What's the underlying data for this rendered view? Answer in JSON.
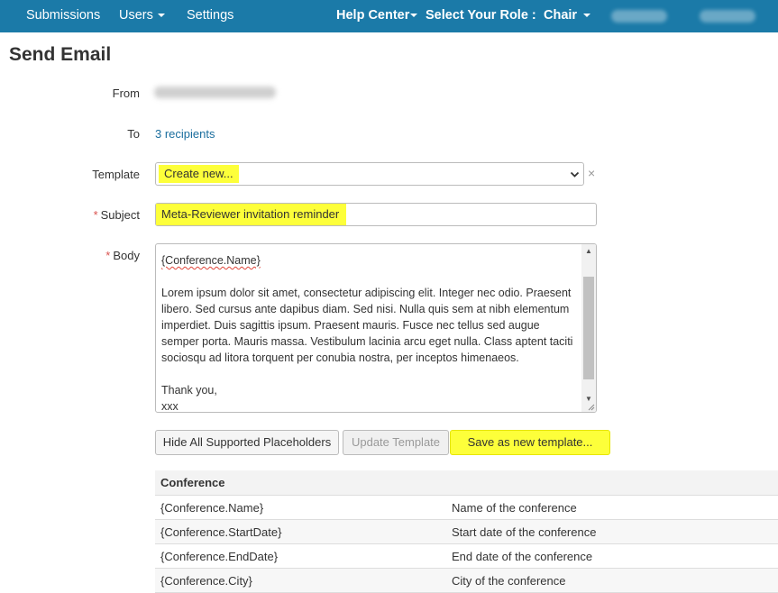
{
  "nav": {
    "submissions": "Submissions",
    "users": "Users",
    "settings": "Settings",
    "help_center": "Help Center",
    "role_label": "Select Your Role :",
    "role_value": "Chair"
  },
  "page_title": "Send Email",
  "form": {
    "from_label": "From",
    "to_label": "To",
    "to_value": "3 recipients",
    "template_label": "Template",
    "template_value": "Create new...",
    "clear_icon": "×",
    "subject_label": "Subject",
    "subject_value": "Meta-Reviewer invitation reminder",
    "body_label": "Body",
    "required_mark": "*"
  },
  "body_text": {
    "line1": "{Conference.Name}",
    "paragraph": "Lorem ipsum dolor sit amet, consectetur adipiscing elit. Integer nec odio. Praesent libero. Sed cursus ante dapibus diam. Sed nisi. Nulla quis sem at nibh elementum imperdiet. Duis sagittis ipsum. Praesent mauris. Fusce nec tellus sed augue semper porta. Mauris massa. Vestibulum lacinia arcu eget nulla. Class aptent taciti sociosqu ad litora torquent per conubia nostra, per inceptos himenaeos.",
    "closing": "Thank you,",
    "signature": "xxx"
  },
  "buttons": {
    "hide_placeholders": "Hide All Supported Placeholders",
    "update_template": "Update Template",
    "save_new_template": "Save as new template..."
  },
  "placeholders": {
    "header": "Conference",
    "rows": [
      {
        "name": "{Conference.Name}",
        "description": "Name of the conference"
      },
      {
        "name": "{Conference.StartDate}",
        "description": "Start date of the conference"
      },
      {
        "name": "{Conference.EndDate}",
        "description": "End date of the conference"
      },
      {
        "name": "{Conference.City}",
        "description": "City of the conference"
      }
    ]
  },
  "icons": {
    "nav_caret": "caret-down-icon",
    "select_chevron": "chevron-down-icon",
    "clear": "close-icon",
    "scroll_up": "arrow-up-icon",
    "scroll_down": "arrow-down-icon",
    "resize": "resize-grip-icon"
  },
  "colors": {
    "nav_bg": "#1b7aa8",
    "highlight": "#fdff3a",
    "link": "#1b6e9e",
    "required": "#d9534f"
  }
}
